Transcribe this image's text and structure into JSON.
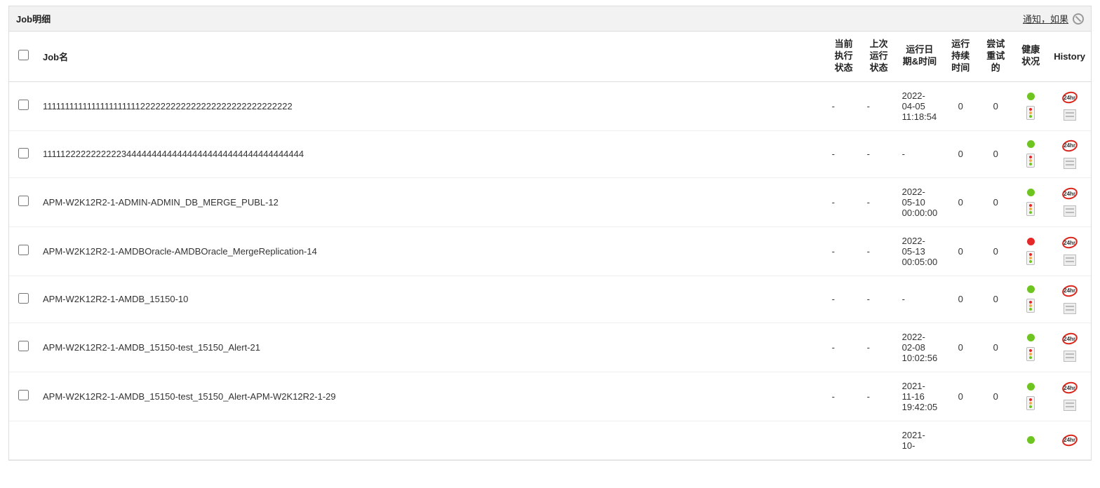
{
  "panel": {
    "title": "Job明细",
    "notify_link": "通知，如果"
  },
  "columns": {
    "job_name": "Job名",
    "current_status": "当前执行状态",
    "last_status": "上次运行状态",
    "run_datetime": "运行日期&时间",
    "duration": "运行持续时间",
    "retries": "尝试重试的",
    "health": "健康状况",
    "history": "History"
  },
  "rows": [
    {
      "name": "1111111111111111111111222222222222222222222222222222",
      "current": "-",
      "last": "-",
      "datetime": "2022-04-05 11:18:54",
      "duration": "0",
      "retries": "0",
      "health_dot": "green"
    },
    {
      "name": "1111122222222222344444444444444444444444444444444444",
      "current": "-",
      "last": "-",
      "datetime": "-",
      "duration": "0",
      "retries": "0",
      "health_dot": "green"
    },
    {
      "name": "APM-W2K12R2-1-ADMIN-ADMIN_DB_MERGE_PUBL-12",
      "current": "-",
      "last": "-",
      "datetime": "2022-05-10 00:00:00",
      "duration": "0",
      "retries": "0",
      "health_dot": "green"
    },
    {
      "name": "APM-W2K12R2-1-AMDBOracle-AMDBOracle_MergeReplication-14",
      "current": "-",
      "last": "-",
      "datetime": "2022-05-13 00:05:00",
      "duration": "0",
      "retries": "0",
      "health_dot": "red"
    },
    {
      "name": "APM-W2K12R2-1-AMDB_15150-10",
      "current": "-",
      "last": "-",
      "datetime": "-",
      "duration": "0",
      "retries": "0",
      "health_dot": "green"
    },
    {
      "name": "APM-W2K12R2-1-AMDB_15150-test_15150_Alert-21",
      "current": "-",
      "last": "-",
      "datetime": "2022-02-08 10:02:56",
      "duration": "0",
      "retries": "0",
      "health_dot": "green"
    },
    {
      "name": "APM-W2K12R2-1-AMDB_15150-test_15150_Alert-APM-W2K12R2-1-29",
      "current": "-",
      "last": "-",
      "datetime": "2021-11-16 19:42:05",
      "duration": "0",
      "retries": "0",
      "health_dot": "green"
    },
    {
      "name": "",
      "current": "",
      "last": "",
      "datetime": "2021-10-",
      "duration": "",
      "retries": "",
      "health_dot": "green"
    }
  ],
  "badge24_text": "24hr"
}
